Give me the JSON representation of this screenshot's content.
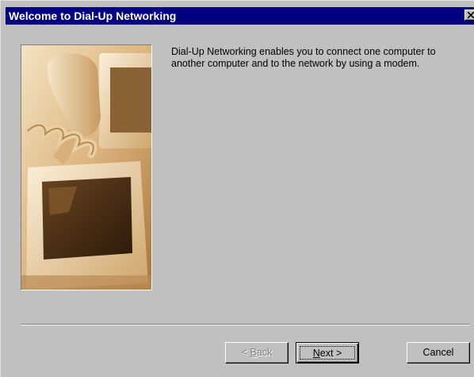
{
  "window": {
    "title": "Welcome to Dial-Up Networking",
    "close_label": "Close"
  },
  "main": {
    "description": "Dial-Up Networking enables you to connect one computer to another computer and to the network by using a modem."
  },
  "buttons": {
    "back": {
      "accel": "B",
      "rest": "ack",
      "prefix": "< ",
      "enabled": false
    },
    "next": {
      "accel": "N",
      "rest": "ext",
      "suffix": " >",
      "enabled": true,
      "default": true
    },
    "cancel": {
      "label": "Cancel",
      "enabled": true
    }
  },
  "colors": {
    "titlebar": "#000080",
    "dialog_face": "#c0c0c0",
    "photo_tint": "#c8a070"
  }
}
